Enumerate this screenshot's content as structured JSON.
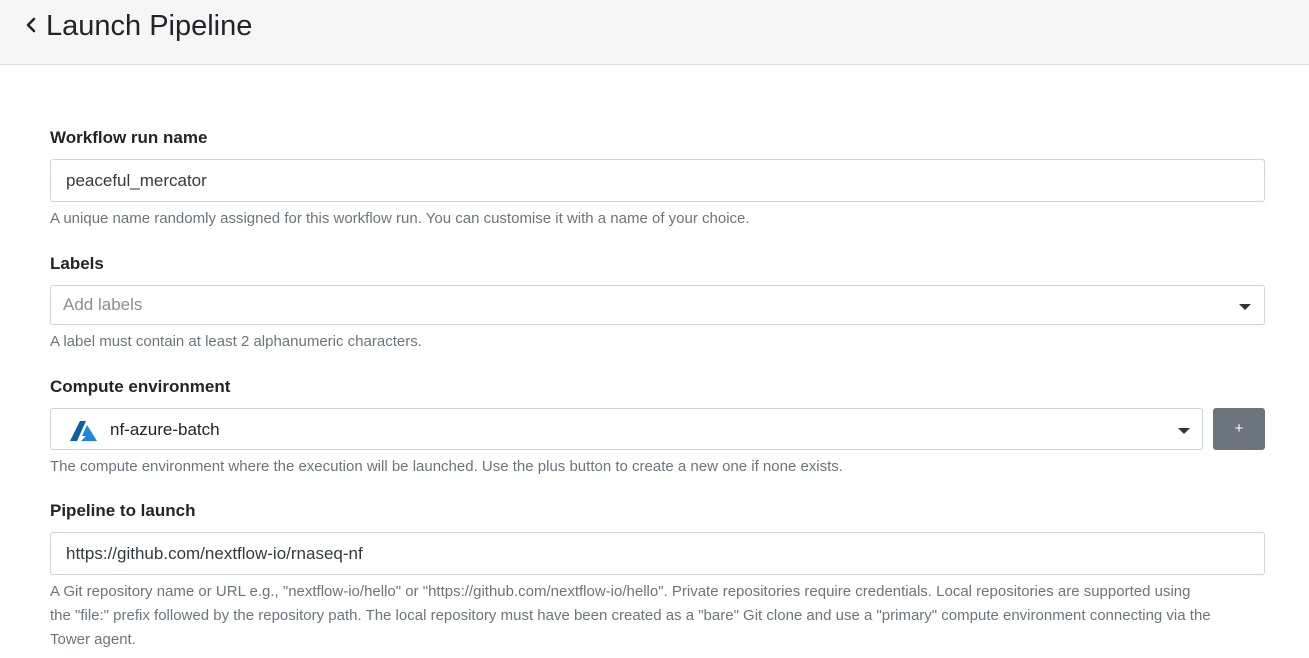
{
  "header": {
    "title": "Launch Pipeline",
    "back_icon": "chevron-left-icon"
  },
  "workflow_run_name": {
    "label": "Workflow run name",
    "value": "peaceful_mercator",
    "help": "A unique name randomly assigned for this workflow run. You can customise it with a name of your choice."
  },
  "labels": {
    "label": "Labels",
    "placeholder": "Add labels",
    "help": "A label must contain at least 2 alphanumeric characters."
  },
  "compute_environment": {
    "label": "Compute environment",
    "selected": "nf-azure-batch",
    "provider_icon": "azure-icon",
    "add_label": "+",
    "help": "The compute environment where the execution will be launched. Use the plus button to create a new one if none exists."
  },
  "pipeline": {
    "label": "Pipeline to launch",
    "value": "https://github.com/nextflow-io/rnaseq-nf",
    "help_lines": [
      "A Git repository name or URL e.g., \"nextflow-io/hello\" or \"https://github.com/nextflow-io/hello\". Private repositories require credentials. Local repositories are supported using",
      "the \"file:\" prefix followed by the repository path. The local repository must have been created as a \"bare\" Git clone and use a \"primary\" compute environment connecting via the",
      "Tower agent."
    ]
  },
  "colors": {
    "header_bg": "#f6f6f6",
    "azure_blue": "#0078d4",
    "secondary_button": "#6c757d",
    "help_text": "#6c757d"
  }
}
